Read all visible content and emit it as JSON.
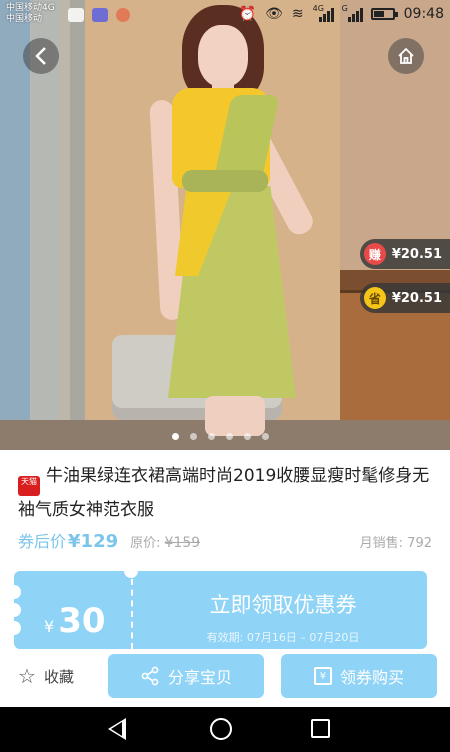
{
  "status_bar": {
    "carrier_1": "中国移动4G",
    "carrier_2": "中国移动",
    "network_1": "4G",
    "network_2": "G",
    "time": "09:48",
    "battery_level": 0.6
  },
  "nav": {
    "back_icon": "chevron-left",
    "home_icon": "house"
  },
  "badges": {
    "earn_icon_text": "赚",
    "earn_amount": "¥20.51",
    "save_icon_text": "省",
    "save_amount": "¥20.51"
  },
  "carousel": {
    "total": 6,
    "active_index": 0
  },
  "product": {
    "store_tag": "天猫",
    "title": "牛油果绿连衣裙高端时尚2019收腰显瘦时髦修身无袖气质女神范衣服",
    "after_coupon_label": "券后价",
    "after_coupon_price": "¥129",
    "original_label": "原价:",
    "original_price": "¥159",
    "monthly_sales": "月销售: 792"
  },
  "coupon": {
    "currency": "¥",
    "amount": "30",
    "cta": "立即领取优惠券",
    "validity": "有效期: 07月16日 – 07月20日"
  },
  "actions": {
    "favorite_label": "收藏",
    "share_label": "分享宝贝",
    "buy_label": "领券购买",
    "coupon_icon_text": "¥"
  },
  "colors": {
    "accent": "#8fd3f6",
    "price_text": "#7cc5ea",
    "earn_badge": "#e84a4a",
    "save_badge": "#f5c518"
  }
}
